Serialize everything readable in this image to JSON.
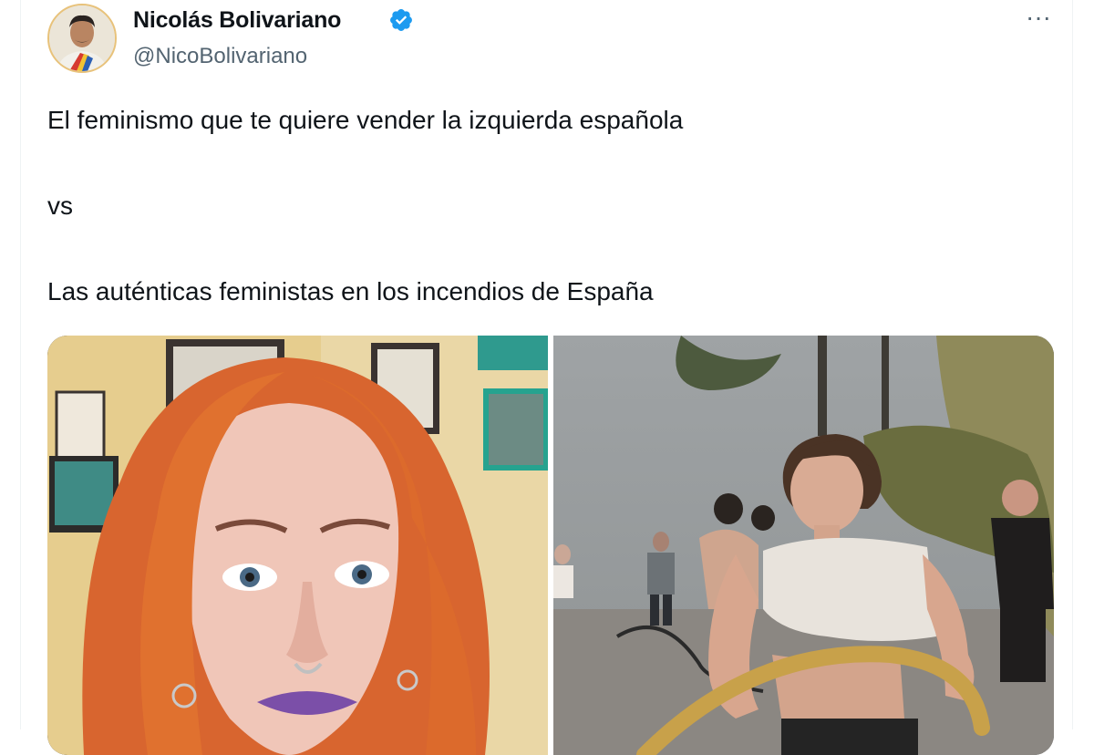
{
  "author": {
    "name": "Nicolás Bolivariano",
    "handle": "@NicoBolivariano",
    "verified": true,
    "avatar_icon": "profile-photo-avatar",
    "verified_icon": "verified-badge-icon"
  },
  "actions": {
    "more_label": "···",
    "more_icon": "more-options-icon"
  },
  "tweet": {
    "lines": [
      "El feminismo que te quiere vender la izquierda española",
      "vs",
      "Las auténticas feministas en los incendios de España"
    ]
  },
  "media": {
    "count": 2,
    "items": [
      {
        "kind": "photo",
        "subject": "woman-orange-hair-selfie"
      },
      {
        "kind": "photo",
        "subject": "woman-with-hose-wildfire"
      }
    ]
  },
  "colors": {
    "text": "#0f1419",
    "secondary": "#536471",
    "verified_blue": "#1d9bf0",
    "divider": "#eff3f4"
  }
}
